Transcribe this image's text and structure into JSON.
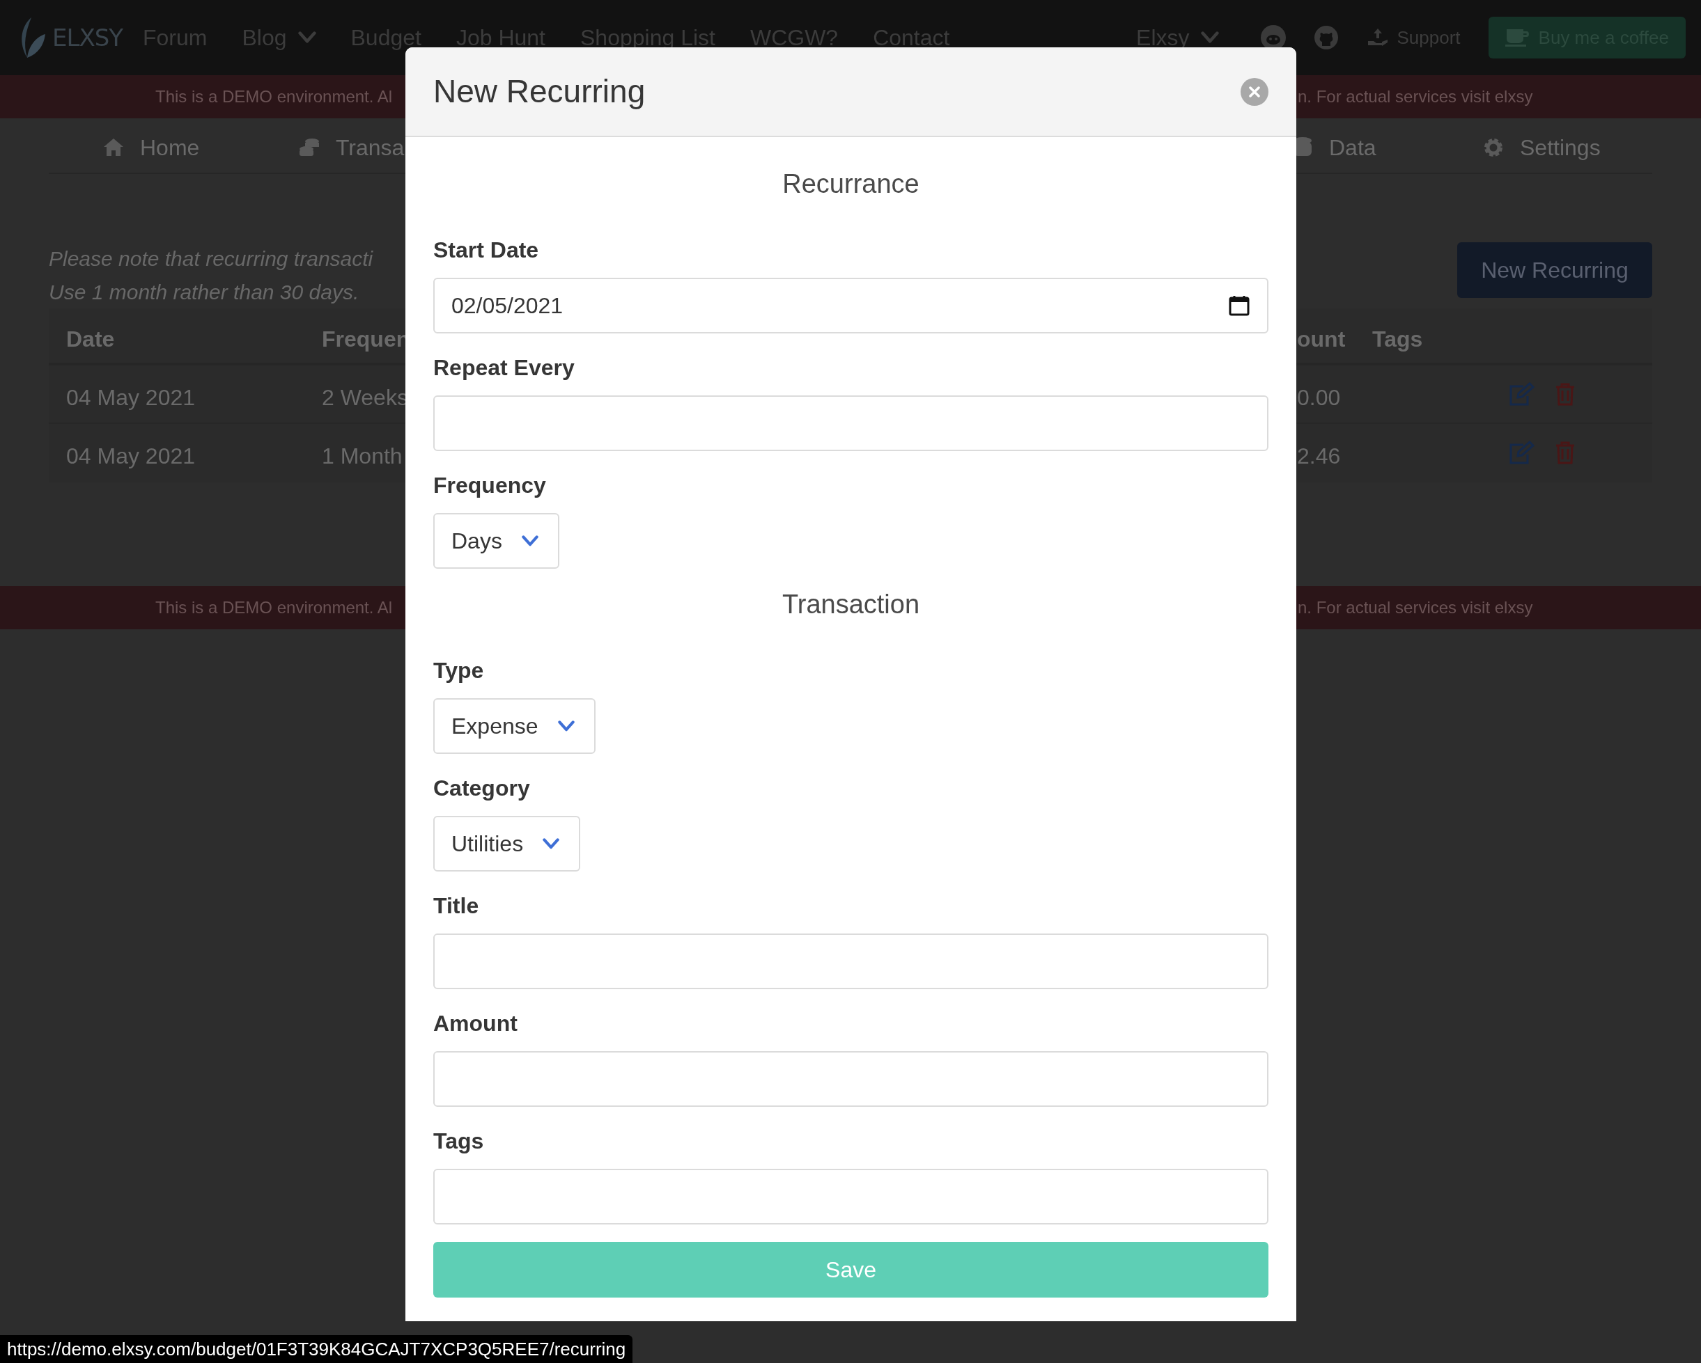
{
  "navbar": {
    "logo": "ELXSY",
    "links": [
      {
        "label": "Forum",
        "dropdown": false
      },
      {
        "label": "Blog",
        "dropdown": true
      },
      {
        "label": "Budget",
        "dropdown": false
      },
      {
        "label": "Job Hunt",
        "dropdown": false
      },
      {
        "label": "Shopping List",
        "dropdown": false
      },
      {
        "label": "WCGW?",
        "dropdown": false
      },
      {
        "label": "Contact",
        "dropdown": false
      }
    ],
    "account": "Elxsy",
    "support": "Support",
    "coffee": "Buy me a coffee"
  },
  "demo_banner": {
    "left": "This is a DEMO environment. Al",
    "right": "n. For actual services visit elxsy"
  },
  "subnav": {
    "left": [
      {
        "label": "Home"
      },
      {
        "label": "Transa"
      }
    ],
    "right": [
      {
        "label": "Data"
      },
      {
        "label": "Settings"
      }
    ]
  },
  "note": [
    "Please note that recurring transacti",
    "Use 1 month rather than 30 days."
  ],
  "new_button": "New Recurring",
  "table": {
    "left_columns": [
      "Date",
      "Frequen"
    ],
    "right_columns": [
      "ount",
      "Tags"
    ],
    "rows": [
      {
        "date": "04 May 2021",
        "frequency": "2 Weeks",
        "amount": "0.00"
      },
      {
        "date": "04 May 2021",
        "frequency": "1 Month",
        "amount": "2.46"
      }
    ]
  },
  "modal": {
    "title": "New Recurring",
    "fields": [
      {
        "kind": "heading",
        "label": "Recurrance"
      },
      {
        "kind": "date",
        "label": "Start Date",
        "value": "02/05/2021"
      },
      {
        "kind": "text",
        "label": "Repeat Every"
      },
      {
        "kind": "select",
        "label": "Frequency",
        "value": "Days"
      },
      {
        "kind": "heading",
        "label": "Transaction"
      },
      {
        "kind": "select",
        "label": "Type",
        "value": "Expense"
      },
      {
        "kind": "select",
        "label": "Category",
        "value": "Utilities"
      },
      {
        "kind": "text",
        "label": "Title"
      },
      {
        "kind": "text",
        "label": "Amount"
      },
      {
        "kind": "text",
        "label": "Tags"
      }
    ],
    "save": "Save"
  },
  "bottom_banner": {
    "left": "This is a DEMO environment. Al",
    "right": "n. For actual services visit elxsy"
  },
  "status_url": "https://demo.elxsy.com/budget/01F3T39K84GCAJT7XCP3Q5REE7/recurring"
}
